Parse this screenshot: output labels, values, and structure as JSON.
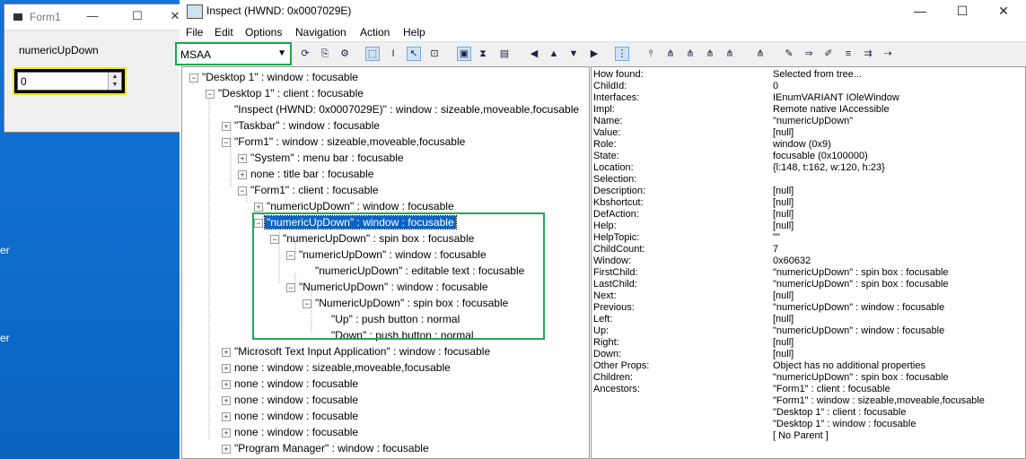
{
  "desktop": {
    "labels": [
      "er",
      "er"
    ]
  },
  "form1": {
    "title": "Form1",
    "label": "numericUpDown",
    "value": "0",
    "buttons": {
      "minimize": "—",
      "maximize": "☐",
      "close": "✕"
    }
  },
  "inspect": {
    "title": "Inspect  (HWND: 0x0007029E)",
    "window_buttons": {
      "minimize": "—",
      "maximize": "☐",
      "close": "✕"
    },
    "menu": [
      "File",
      "Edit",
      "Options",
      "Navigation",
      "Action",
      "Help"
    ],
    "mode_select": {
      "value": "MSAA"
    },
    "tree": [
      {
        "label": "\"Desktop 1\" : window : focusable",
        "box": "−"
      },
      {
        "label": "\"Desktop 1\" : client : focusable",
        "box": "−"
      },
      {
        "label": "\"Inspect  (HWND: 0x0007029E)\" : window : sizeable,moveable,focusable",
        "box": ""
      },
      {
        "label": "\"Taskbar\" : window : focusable",
        "box": "+"
      },
      {
        "label": "\"Form1\" : window : sizeable,moveable,focusable",
        "box": "−"
      },
      {
        "label": "\"System\" : menu bar : focusable",
        "box": "+"
      },
      {
        "label": "none : title bar : focusable",
        "box": "+"
      },
      {
        "label": "\"Form1\" : client : focusable",
        "box": "−"
      },
      {
        "label": "\"numericUpDown\" : window : focusable",
        "box": "+"
      },
      {
        "label": "\"numericUpDown\" : window : focusable",
        "box": "−",
        "selected": true
      },
      {
        "label": "\"numericUpDown\" : spin box : focusable",
        "box": "−"
      },
      {
        "label": "\"numericUpDown\" : window : focusable",
        "box": "−"
      },
      {
        "label": "\"numericUpDown\" : editable text : focusable",
        "box": ""
      },
      {
        "label": "\"NumericUpDown\" : window : focusable",
        "box": "−"
      },
      {
        "label": "\"NumericUpDown\" : spin box : focusable",
        "box": "−"
      },
      {
        "label": "\"Up\" : push button : normal",
        "box": ""
      },
      {
        "label": "\"Down\" : push button : normal",
        "box": ""
      },
      {
        "label": "\"Microsoft Text Input Application\" : window : focusable",
        "box": "+"
      },
      {
        "label": "none : window : sizeable,moveable,focusable",
        "box": "+"
      },
      {
        "label": "none : window : focusable",
        "box": "+"
      },
      {
        "label": "none : window : focusable",
        "box": "+"
      },
      {
        "label": "none : window : focusable",
        "box": "+"
      },
      {
        "label": "none : window : focusable",
        "box": "+"
      },
      {
        "label": "\"Program Manager\" : window : focusable",
        "box": "+"
      }
    ],
    "properties": [
      {
        "k": "How found:",
        "v": "Selected from tree..."
      },
      {
        "k": "ChildId:",
        "v": "0"
      },
      {
        "k": "Interfaces:",
        "v": "IEnumVARIANT IOleWindow"
      },
      {
        "k": "Impl:",
        "v": "Remote native IAccessible"
      },
      {
        "k": "Name:",
        "v": "\"numericUpDown\""
      },
      {
        "k": "Value:",
        "v": "[null]"
      },
      {
        "k": "Role:",
        "v": "window (0x9)"
      },
      {
        "k": "State:",
        "v": "focusable (0x100000)"
      },
      {
        "k": "Location:",
        "v": "{l:148, t:162, w:120, h:23}"
      },
      {
        "k": "Selection:",
        "v": ""
      },
      {
        "k": "Description:",
        "v": "[null]"
      },
      {
        "k": "Kbshortcut:",
        "v": "[null]"
      },
      {
        "k": "DefAction:",
        "v": "[null]"
      },
      {
        "k": "Help:",
        "v": "[null]"
      },
      {
        "k": "HelpTopic:",
        "v": "\"\""
      },
      {
        "k": "ChildCount:",
        "v": "7"
      },
      {
        "k": "Window:",
        "v": "0x60632"
      },
      {
        "k": "FirstChild:",
        "v": "\"numericUpDown\" : spin box : focusable"
      },
      {
        "k": "LastChild:",
        "v": "\"numericUpDown\" : spin box : focusable"
      },
      {
        "k": "Next:",
        "v": "[null]"
      },
      {
        "k": "Previous:",
        "v": "\"numericUpDown\" : window : focusable"
      },
      {
        "k": "Left:",
        "v": "[null]"
      },
      {
        "k": "Up:",
        "v": "\"numericUpDown\" : window : focusable"
      },
      {
        "k": "Right:",
        "v": "[null]"
      },
      {
        "k": "Down:",
        "v": "[null]"
      },
      {
        "k": "Other Props:",
        "v": "Object has no additional properties"
      },
      {
        "k": "Children:",
        "v": "\"numericUpDown\" : spin box : focusable"
      },
      {
        "k": "Ancestors:",
        "v": "\"Form1\" : client : focusable"
      },
      {
        "k": "",
        "v": "\"Form1\" : window : sizeable,moveable,focusable"
      },
      {
        "k": "",
        "v": "\"Desktop 1\" : client : focusable"
      },
      {
        "k": "",
        "v": "\"Desktop 1\" : window : focusable"
      },
      {
        "k": "",
        "v": "[ No Parent ]"
      }
    ]
  }
}
